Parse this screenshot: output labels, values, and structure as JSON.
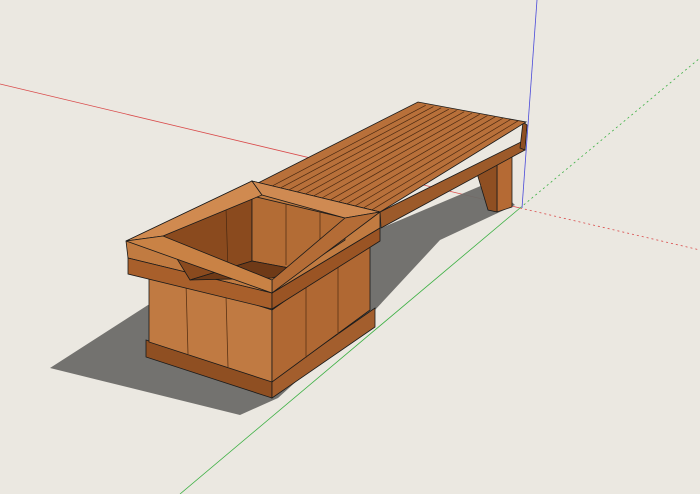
{
  "viewport": {
    "model": "bench-with-planter",
    "colors": {
      "background": "#ebe8e1",
      "axis_red": "#d94a4a",
      "axis_green": "#3cb043",
      "axis_blue": "#4a4ad9",
      "wood_light": "#c97d45",
      "wood_mid": "#b56a34",
      "wood_dark": "#8f4f22",
      "wood_plank": "#a35e2d",
      "shadow": "#6d6b68",
      "edge": "#1a1a1a"
    }
  }
}
